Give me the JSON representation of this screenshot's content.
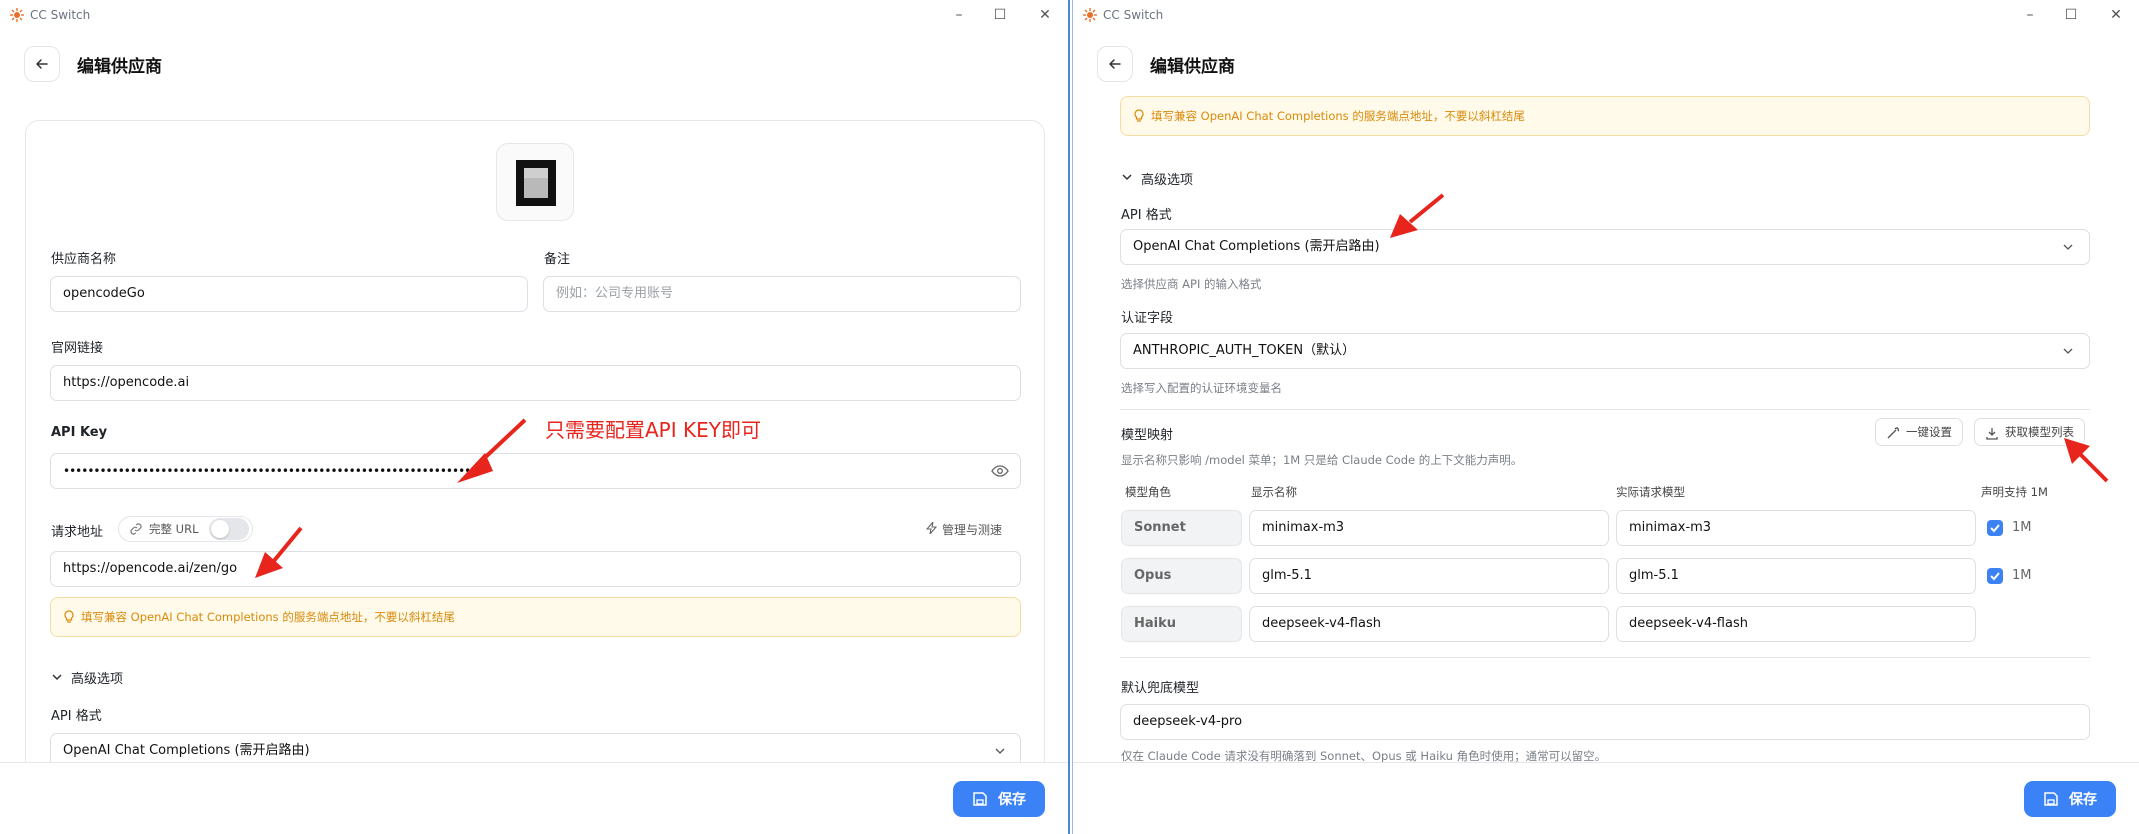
{
  "app_title": "CC Switch",
  "page_title": "编辑供应商",
  "save_label": "保存",
  "left": {
    "name_label": "供应商名称",
    "name_value": "opencodeGo",
    "note_label": "备注",
    "note_placeholder": "例如：公司专用账号",
    "website_label": "官网链接",
    "website_value": "https://opencode.ai",
    "apikey_label": "API Key",
    "apikey_value": "••••••••••••••••••••••••••••••••••••••••••••••••••••••••••••••••••••",
    "annotation": "只需要配置API KEY即可",
    "url_label": "请求地址",
    "full_url_label": "完整 URL",
    "manage_label": "管理与测速",
    "url_value": "https://opencode.ai/zen/go",
    "notice": "填写兼容 OpenAI Chat Completions 的服务端点地址，不要以斜杠结尾",
    "advanced_label": "高级选项",
    "api_format_label": "API 格式",
    "api_format_value": "OpenAI Chat Completions (需开启路由)"
  },
  "right": {
    "notice": "填写兼容 OpenAI Chat Completions 的服务端点地址，不要以斜杠结尾",
    "advanced_label": "高级选项",
    "api_format_label": "API 格式",
    "api_format_value": "OpenAI Chat Completions (需开启路由)",
    "api_format_hint": "选择供应商 API 的输入格式",
    "auth_label": "认证字段",
    "auth_value": "ANTHROPIC_AUTH_TOKEN（默认）",
    "auth_hint": "选择写入配置的认证环境变量名",
    "mapping_title": "模型映射",
    "mapping_hint": "显示名称只影响 /model 菜单；1M 只是给 Claude Code 的上下文能力声明。",
    "one_click_label": "一键设置",
    "fetch_models_label": "获取模型列表",
    "col_role": "模型角色",
    "col_display": "显示名称",
    "col_actual": "实际请求模型",
    "col_1m": "声明支持 1M",
    "rows": [
      {
        "role": "Sonnet",
        "display": "minimax-m3",
        "actual": "minimax-m3",
        "one_m": "1M",
        "checked": true
      },
      {
        "role": "Opus",
        "display": "glm-5.1",
        "actual": "glm-5.1",
        "one_m": "1M",
        "checked": true
      },
      {
        "role": "Haiku",
        "display": "deepseek-v4-flash",
        "actual": "deepseek-v4-flash",
        "one_m": "",
        "checked": false
      }
    ],
    "fallback_label": "默认兜底模型",
    "fallback_value": "deepseek-v4-pro",
    "fallback_hint": "仅在 Claude Code 请求没有明确落到 Sonnet、Opus 或 Haiku 角色时使用；通常可以留空。"
  },
  "colors": {
    "accent": "#3b82f6",
    "annotation_red": "#e8251d",
    "notice_text": "#d98a0a",
    "notice_bg": "#fffaea"
  }
}
